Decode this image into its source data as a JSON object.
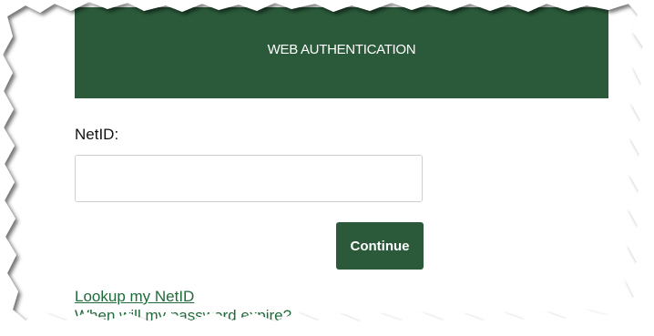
{
  "header": {
    "title": "WEB AUTHENTICATION"
  },
  "form": {
    "netid_label": "NetID:",
    "netid_value": "",
    "continue_label": "Continue"
  },
  "links": [
    {
      "label": "Lookup my NetID"
    },
    {
      "label": "When will my password expire?"
    }
  ],
  "colors": {
    "brand_green": "#2a5a3a",
    "link_green": "#1f6b3a"
  }
}
